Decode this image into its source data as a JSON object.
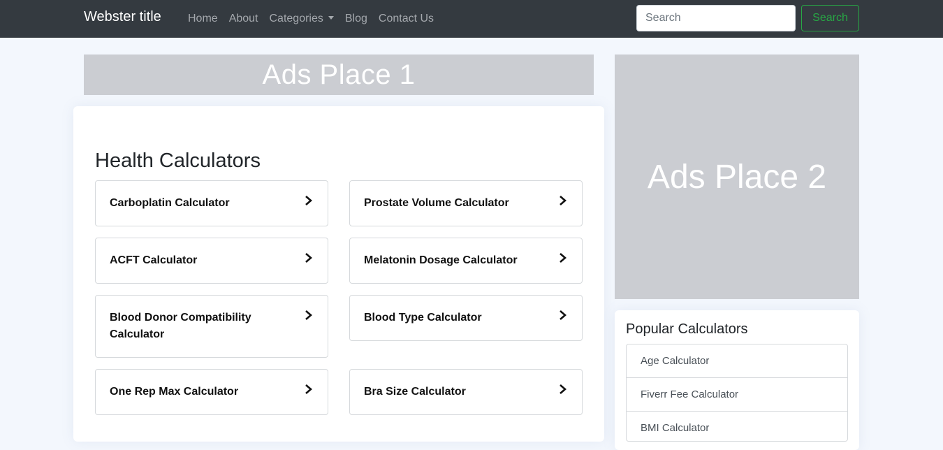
{
  "navbar": {
    "brand": "Webster title",
    "links": [
      "Home",
      "About",
      "Categories",
      "Blog",
      "Contact Us"
    ],
    "search_placeholder": "Search",
    "search_button": "Search"
  },
  "ads": {
    "top": "Ads Place 1",
    "side": "Ads Place 2"
  },
  "main": {
    "title": "Health Calculators",
    "calculators": [
      "Carboplatin Calculator",
      "Prostate Volume Calculator",
      "ACFT Calculator",
      "Melatonin Dosage Calculator",
      "Blood Donor Compatibility Calculator",
      "Blood Type Calculator",
      "One Rep Max Calculator",
      "Bra Size Calculator"
    ]
  },
  "sidebar": {
    "title": "Popular Calculators",
    "items": [
      "Age Calculator",
      "Fiverr Fee Calculator",
      "BMI Calculator"
    ]
  },
  "colors": {
    "navbar_bg": "#343a40",
    "accent_green": "#28a745",
    "ad_bg": "#cbcdd2",
    "page_bg": "#f3f7fd"
  }
}
